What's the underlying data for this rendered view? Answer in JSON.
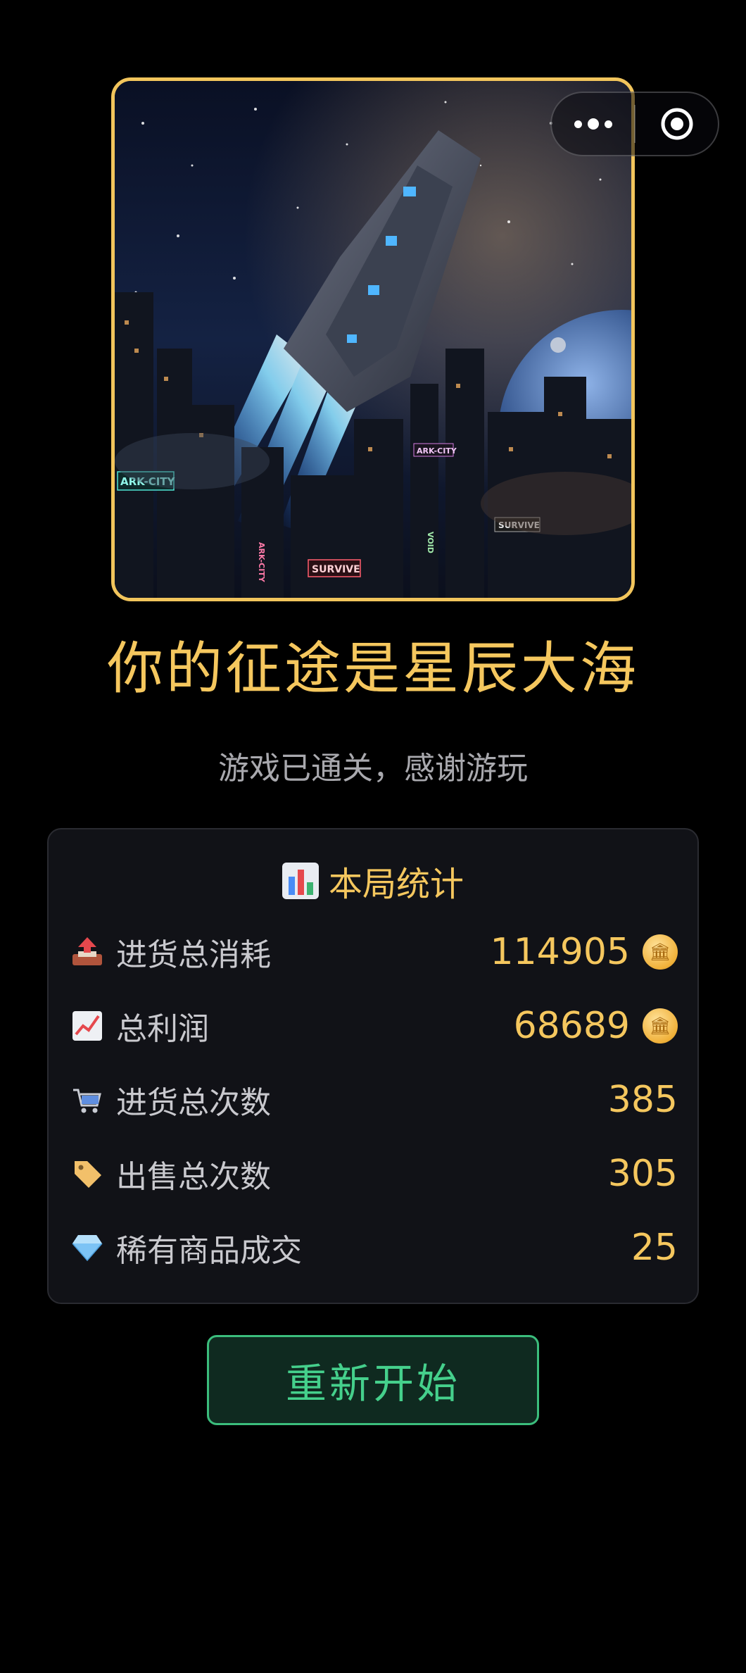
{
  "header": {
    "more_icon": "more-dots-icon",
    "close_icon": "target-circle-icon"
  },
  "hero": {
    "sign_1": "ARK-CITY",
    "sign_2": "ARK-CITY",
    "sign_3": "SURVIVE",
    "sign_4": "SURVIVE",
    "sign_5": "ARK-CITY",
    "sign_6": "VOID"
  },
  "title": "你的征途是星辰大海",
  "subtitle": "游戏已通关，感谢游玩",
  "stats": {
    "heading": "本局统计",
    "heading_icon": "bar-chart-icon",
    "rows": [
      {
        "icon": "outbox-tray-icon",
        "label": "进货总消耗",
        "value": "114905",
        "coin": true
      },
      {
        "icon": "chart-increasing-icon",
        "label": "总利润",
        "value": "68689",
        "coin": true
      },
      {
        "icon": "shopping-cart-icon",
        "label": "进货总次数",
        "value": "385",
        "coin": false
      },
      {
        "icon": "label-tag-icon",
        "label": "出售总次数",
        "value": "305",
        "coin": false
      },
      {
        "icon": "gem-icon",
        "label": "稀有商品成交",
        "value": "25",
        "coin": false
      }
    ]
  },
  "colors": {
    "accent_gold": "#f5c75e",
    "button_green": "#45d08c",
    "card_bg": "#111217"
  },
  "restart_label": "重新开始"
}
